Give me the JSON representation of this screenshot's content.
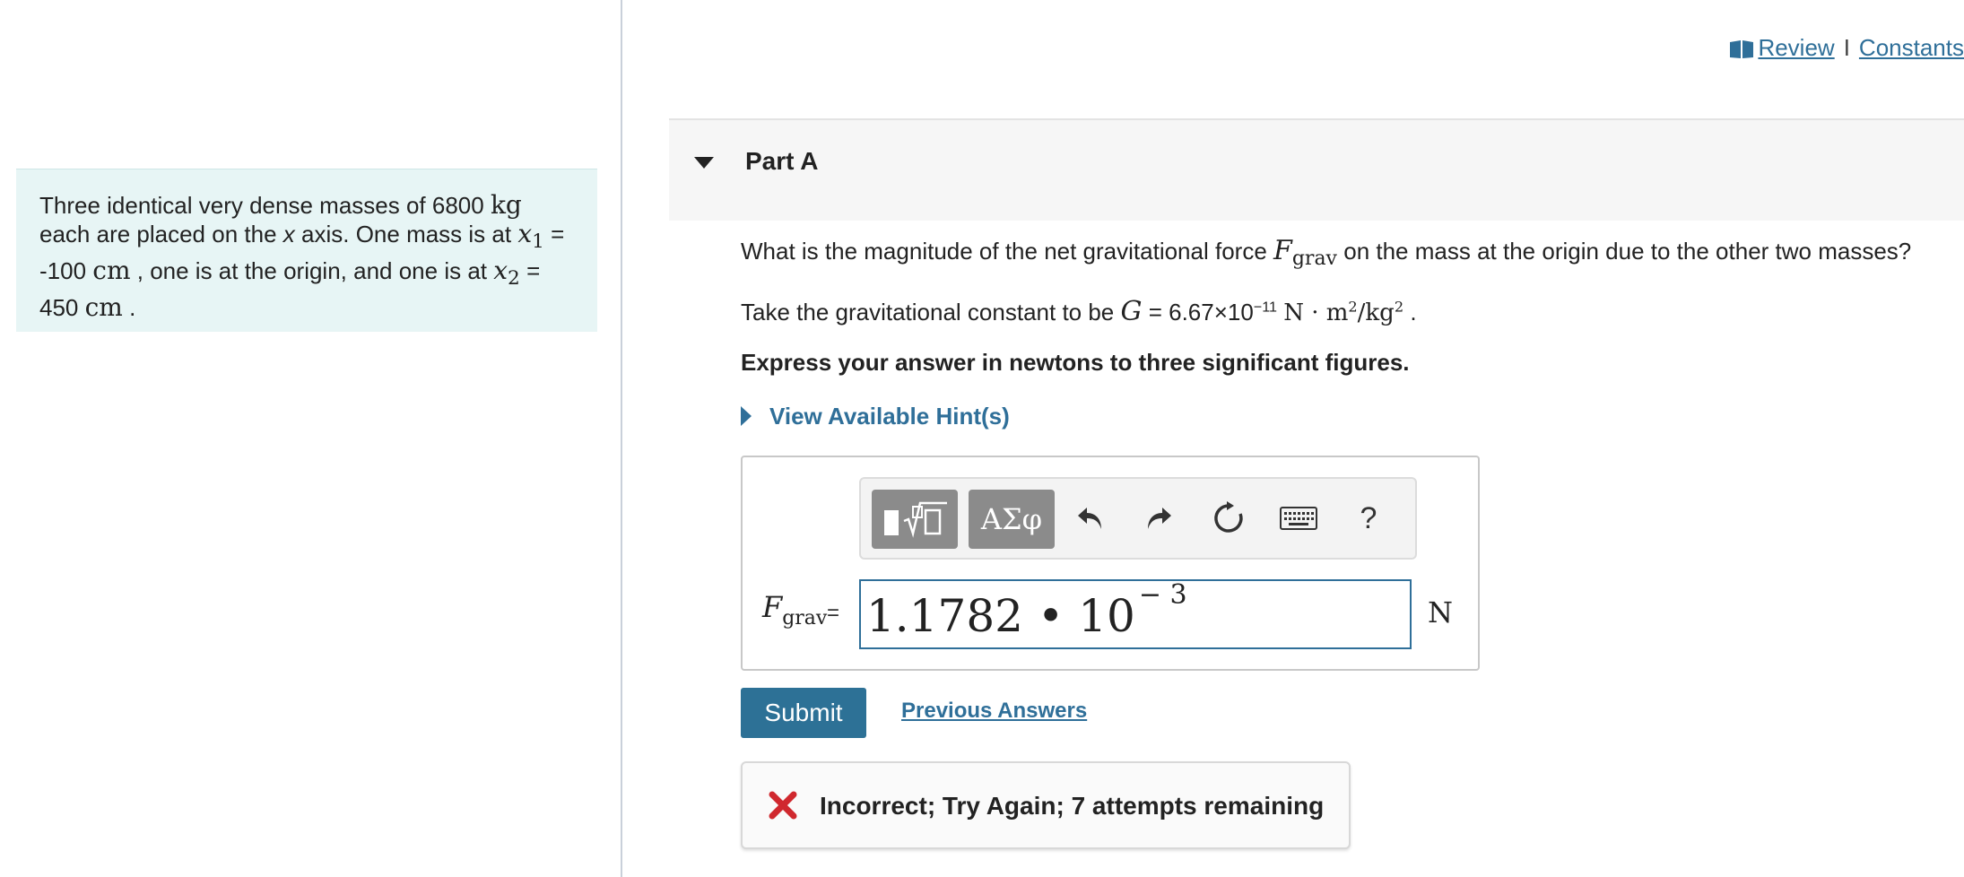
{
  "header": {
    "review_link": "Review",
    "separator": "I",
    "constants_link": "Constants"
  },
  "intro": {
    "line1_pre": "Three identical very dense masses of 6800",
    "mass_unit": "kg",
    "line2": "each are placed on the",
    "axis_var": "x",
    "line2b": "axis. One mass is at",
    "x1": "x",
    "x1_sub": "1",
    "eq": "=",
    "x1_value": "-100",
    "cm": "cm",
    "line3b": ", one is at the origin, and one is at",
    "x2": "x",
    "x2_sub": "2",
    "x2_value": "450",
    "period": "."
  },
  "part": {
    "title": "Part A"
  },
  "question": {
    "q1_pre": "What is the magnitude of the net gravitational force",
    "F": "F",
    "F_sub": "grav",
    "q1_post": "on the mass at the origin due to the other two masses?",
    "q2_pre": "Take the gravitational constant to be",
    "G": "G",
    "G_value": "= 6.67×10",
    "G_exp": "−11",
    "G_units_a": "N · m",
    "sq": "2",
    "G_units_b": "/kg",
    "period": ".",
    "instructions": "Express your answer in newtons to three significant figures.",
    "hint_label": "View Available Hint(s)"
  },
  "answer": {
    "toolbar": {
      "greek_label": "ΑΣφ",
      "help_label": "?"
    },
    "var": "F",
    "var_sub": "grav",
    "eq": "=",
    "value": "1.1782 • 10",
    "exponent": "− 3",
    "unit": "N"
  },
  "actions": {
    "submit_label": "Submit",
    "previous_answers": "Previous Answers"
  },
  "feedback": {
    "message": "Incorrect; Try Again; 7 attempts remaining",
    "status_color": "#d0282e"
  }
}
